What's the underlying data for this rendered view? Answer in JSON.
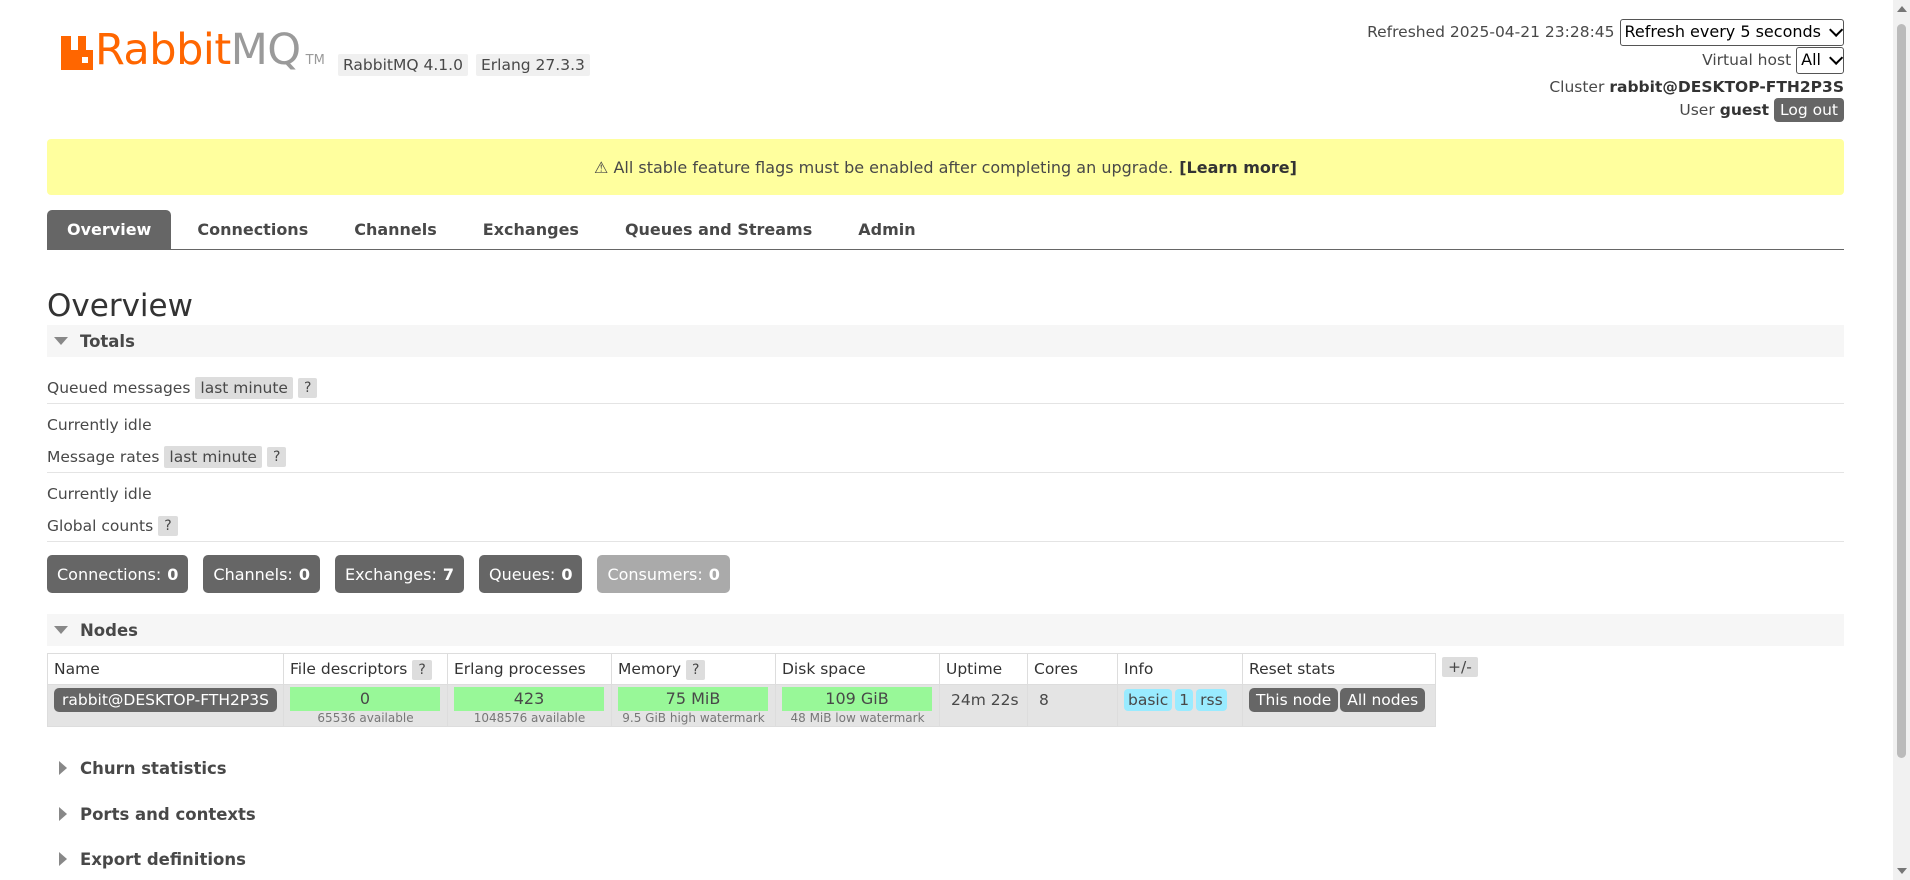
{
  "logo": {
    "rabbit": "Rabbit",
    "mq": "MQ",
    "tm": "TM"
  },
  "versions": {
    "rabbitmq": "RabbitMQ 4.1.0",
    "erlang": "Erlang 27.3.3"
  },
  "header": {
    "refreshed_label": "Refreshed 2025-04-21 23:28:45",
    "refresh_select": "Refresh every 5 seconds",
    "vhost_label": "Virtual host",
    "vhost_select": "All",
    "cluster_label": "Cluster",
    "cluster_name": "rabbit@DESKTOP-FTH2P3S",
    "user_label": "User",
    "user_name": "guest",
    "logout": "Log out"
  },
  "banner": {
    "text": "⚠ All stable feature flags must be enabled after completing an upgrade.",
    "link": "[Learn more]",
    "color": "#ffff9e"
  },
  "tabs": [
    "Overview",
    "Connections",
    "Channels",
    "Exchanges",
    "Queues and Streams",
    "Admin"
  ],
  "active_tab": "Overview",
  "page_title": "Overview",
  "totals": {
    "title": "Totals",
    "queued_label": "Queued messages",
    "queued_range": "last minute",
    "help": "?",
    "queued_status": "Currently idle",
    "rates_label": "Message rates",
    "rates_range": "last minute",
    "rates_status": "Currently idle",
    "global_label": "Global counts"
  },
  "counts": [
    {
      "label": "Connections:",
      "value": "0"
    },
    {
      "label": "Channels:",
      "value": "0"
    },
    {
      "label": "Exchanges:",
      "value": "7"
    },
    {
      "label": "Queues:",
      "value": "0"
    },
    {
      "label": "Consumers:",
      "value": "0"
    }
  ],
  "nodes": {
    "title": "Nodes",
    "columns": [
      "Name",
      "File descriptors",
      "Erlang processes",
      "Memory",
      "Disk space",
      "Uptime",
      "Cores",
      "Info",
      "Reset stats"
    ],
    "plus_minus": "+/-",
    "row": {
      "name": "rabbit@DESKTOP-FTH2P3S",
      "fd": "0",
      "fd_sub": "65536 available",
      "procs": "423",
      "procs_sub": "1048576 available",
      "memory": "75 MiB",
      "memory_sub": "9.5 GiB high watermark",
      "disk": "109 GiB",
      "disk_sub": "48 MiB low watermark",
      "uptime": "24m 22s",
      "cores": "8",
      "info": [
        "basic",
        "1",
        "rss"
      ],
      "reset_this": "This node",
      "reset_all": "All nodes"
    }
  },
  "collapsed_sections": [
    "Churn statistics",
    "Ports and contexts",
    "Export definitions"
  ],
  "colors": {
    "accent": "#ff6600",
    "green_bar": "#98f898",
    "info_badge": "#99ebff",
    "dark_button": "#666666"
  }
}
